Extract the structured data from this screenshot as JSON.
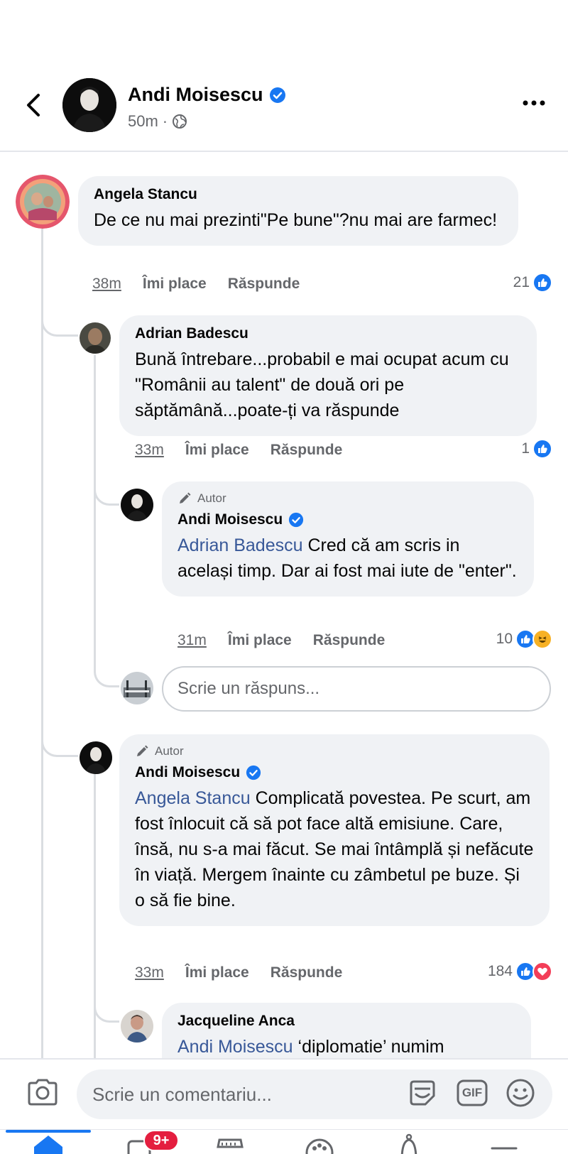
{
  "header": {
    "name": "Andi Moisescu",
    "time": "50m",
    "separator": "·"
  },
  "comments": [
    {
      "name": "Angela Stancu",
      "text": "De ce nu mai prezinti\"Pe bune\"?nu mai are farmec!",
      "time": "38m",
      "like": "Îmi place",
      "reply": "Răspunde",
      "reactions": "21"
    },
    {
      "name": "Adrian Badescu",
      "text": "Bună întrebare...probabil e mai ocupat acum cu \"Românii au talent\" de două ori pe săptămână...poate-ți va răspunde",
      "time": "33m",
      "like": "Îmi place",
      "reply": "Răspunde",
      "reactions": "1"
    },
    {
      "badge": "Autor",
      "name": "Andi Moisescu",
      "mention": "Adrian Badescu",
      "text": " Cred că am scris in același timp. Dar ai fost mai iute de \"enter\".",
      "time": "31m",
      "like": "Îmi place",
      "reply": "Răspunde",
      "reactions": "10"
    },
    {
      "badge": "Autor",
      "name": "Andi Moisescu",
      "mention": "Angela Stancu",
      "text": " Complicată povestea. Pe scurt, am fost înlocuit că să pot face altă emisiune. Care, însă, nu s-a mai făcut. Se mai întâmplă și nefăcute în viață. Mergem înainte cu zâmbetul pe buze. Și o să fie bine.",
      "time": "33m",
      "like": "Îmi place",
      "reply": "Răspunde",
      "reactions": "184"
    },
    {
      "name": "Jacqueline Anca",
      "mention": "Andi Moisescu",
      "text": "  ‘diplomatie’  numim"
    }
  ],
  "reply_placeholder": "Scrie un răspuns...",
  "composer": {
    "placeholder": "Scrie un comentariu...",
    "gif": "GIF"
  },
  "tabbar": {
    "video_badge": "9+"
  },
  "colors": {
    "like_blue": "#1877f2",
    "love_red": "#f33e58",
    "haha_yellow": "#f7b125",
    "verified_blue": "#1877f2"
  }
}
